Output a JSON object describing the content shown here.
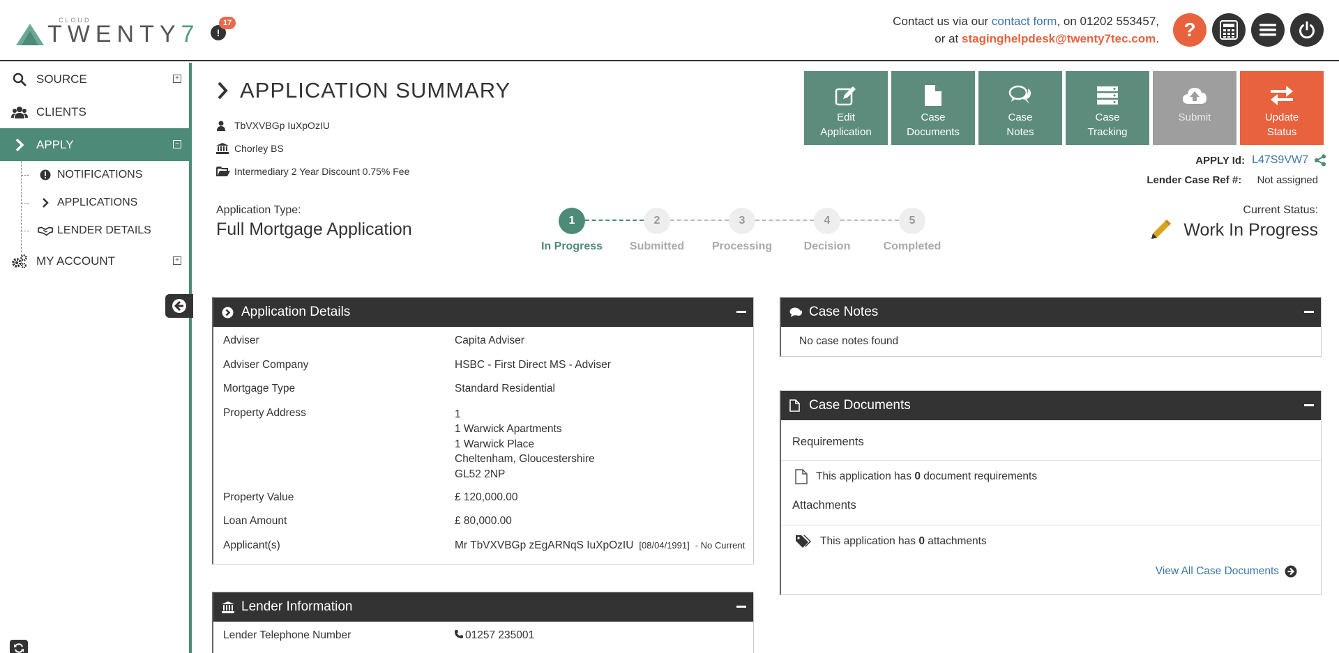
{
  "header": {
    "logo_cloud": "CLOUD",
    "logo_text": "TWENTY",
    "logo_seven": "7",
    "notification_count": "17",
    "contact_prefix": "Contact us via our ",
    "contact_link": "contact form",
    "contact_phone_text": ", on 01202 553457,",
    "contact_or": "or at ",
    "contact_email": "staginghelpdesk@twenty7tec.com",
    "contact_end": ".",
    "help_glyph": "?"
  },
  "sidebar": {
    "items": [
      {
        "label": "SOURCE",
        "toggle": "+"
      },
      {
        "label": "CLIENTS"
      },
      {
        "label": "APPLY",
        "toggle": "−"
      },
      {
        "label": "MY ACCOUNT",
        "toggle": "+"
      }
    ],
    "sub_items": [
      {
        "label": "NOTIFICATIONS"
      },
      {
        "label": "APPLICATIONS"
      },
      {
        "label": "LENDER DETAILS"
      }
    ]
  },
  "page": {
    "title": "APPLICATION SUMMARY",
    "client_name": "TbVXVBGp IuXpOzIU",
    "lender": "Chorley BS",
    "product": "Intermediary 2 Year Discount 0.75% Fee"
  },
  "actions": [
    {
      "line1": "Edit",
      "line2": "Application",
      "icon": "edit-icon"
    },
    {
      "line1": "Case",
      "line2": "Documents",
      "icon": "document-icon"
    },
    {
      "line1": "Case",
      "line2": "Notes",
      "icon": "comments-icon"
    },
    {
      "line1": "Case",
      "line2": "Tracking",
      "icon": "tracking-icon"
    },
    {
      "line1": "Submit",
      "line2": "",
      "icon": "cloud-upload-icon"
    },
    {
      "line1": "Update",
      "line2": "Status",
      "icon": "exchange-icon"
    }
  ],
  "apply": {
    "id_label": "APPLY Id:",
    "id_value": "L47S9VW7",
    "lender_ref_label": "Lender Case Ref #:",
    "lender_ref_value": "Not assigned"
  },
  "application_type": {
    "label": "Application Type:",
    "value": "Full Mortgage Application"
  },
  "progress": {
    "steps": [
      {
        "num": "1",
        "label": "In Progress"
      },
      {
        "num": "2",
        "label": "Submitted"
      },
      {
        "num": "3",
        "label": "Processing"
      },
      {
        "num": "4",
        "label": "Decision"
      },
      {
        "num": "5",
        "label": "Completed"
      }
    ],
    "current_step": 1
  },
  "current_status": {
    "label": "Current Status:",
    "value": "Work In Progress"
  },
  "application_details": {
    "title": "Application Details",
    "rows": [
      {
        "key": "Adviser",
        "value": "Capita Adviser"
      },
      {
        "key": "Adviser Company",
        "value": "HSBC - First Direct MS - Adviser"
      },
      {
        "key": "Mortgage Type",
        "value": "Standard Residential"
      },
      {
        "key": "Property Address",
        "lines": [
          "1",
          "1 Warwick Apartments",
          "1 Warwick Place",
          "Cheltenham, Gloucestershire",
          "GL52 2NP"
        ]
      },
      {
        "key": "Property Value",
        "value": "£ 120,000.00"
      },
      {
        "key": "Loan Amount",
        "value": "£ 80,000.00"
      },
      {
        "key": "Applicant(s)",
        "value": "Mr TbVXVBGp zEgARNqS IuXpOzIU",
        "dob": "[08/04/1991]",
        "status": "- No Current"
      }
    ]
  },
  "case_notes": {
    "title": "Case Notes",
    "empty_text": "No case notes found"
  },
  "case_documents": {
    "title": "Case Documents",
    "requirements_label": "Requirements",
    "req_prefix": "This application has ",
    "req_count": "0",
    "req_suffix": " document requirements",
    "attachments_label": "Attachments",
    "att_prefix": "This application has ",
    "att_count": "0",
    "att_suffix": " attachments",
    "view_all": "View All Case Documents"
  },
  "lender_information": {
    "title": "Lender Information",
    "rows": [
      {
        "key": "Lender Telephone Number",
        "value": "01257 235001"
      }
    ]
  },
  "colors": {
    "brand_green": "#4d8a78",
    "action_green": "#5d8c7d",
    "accent_orange": "#e8623e",
    "dark": "#333333",
    "link_blue": "#3a76a8"
  }
}
